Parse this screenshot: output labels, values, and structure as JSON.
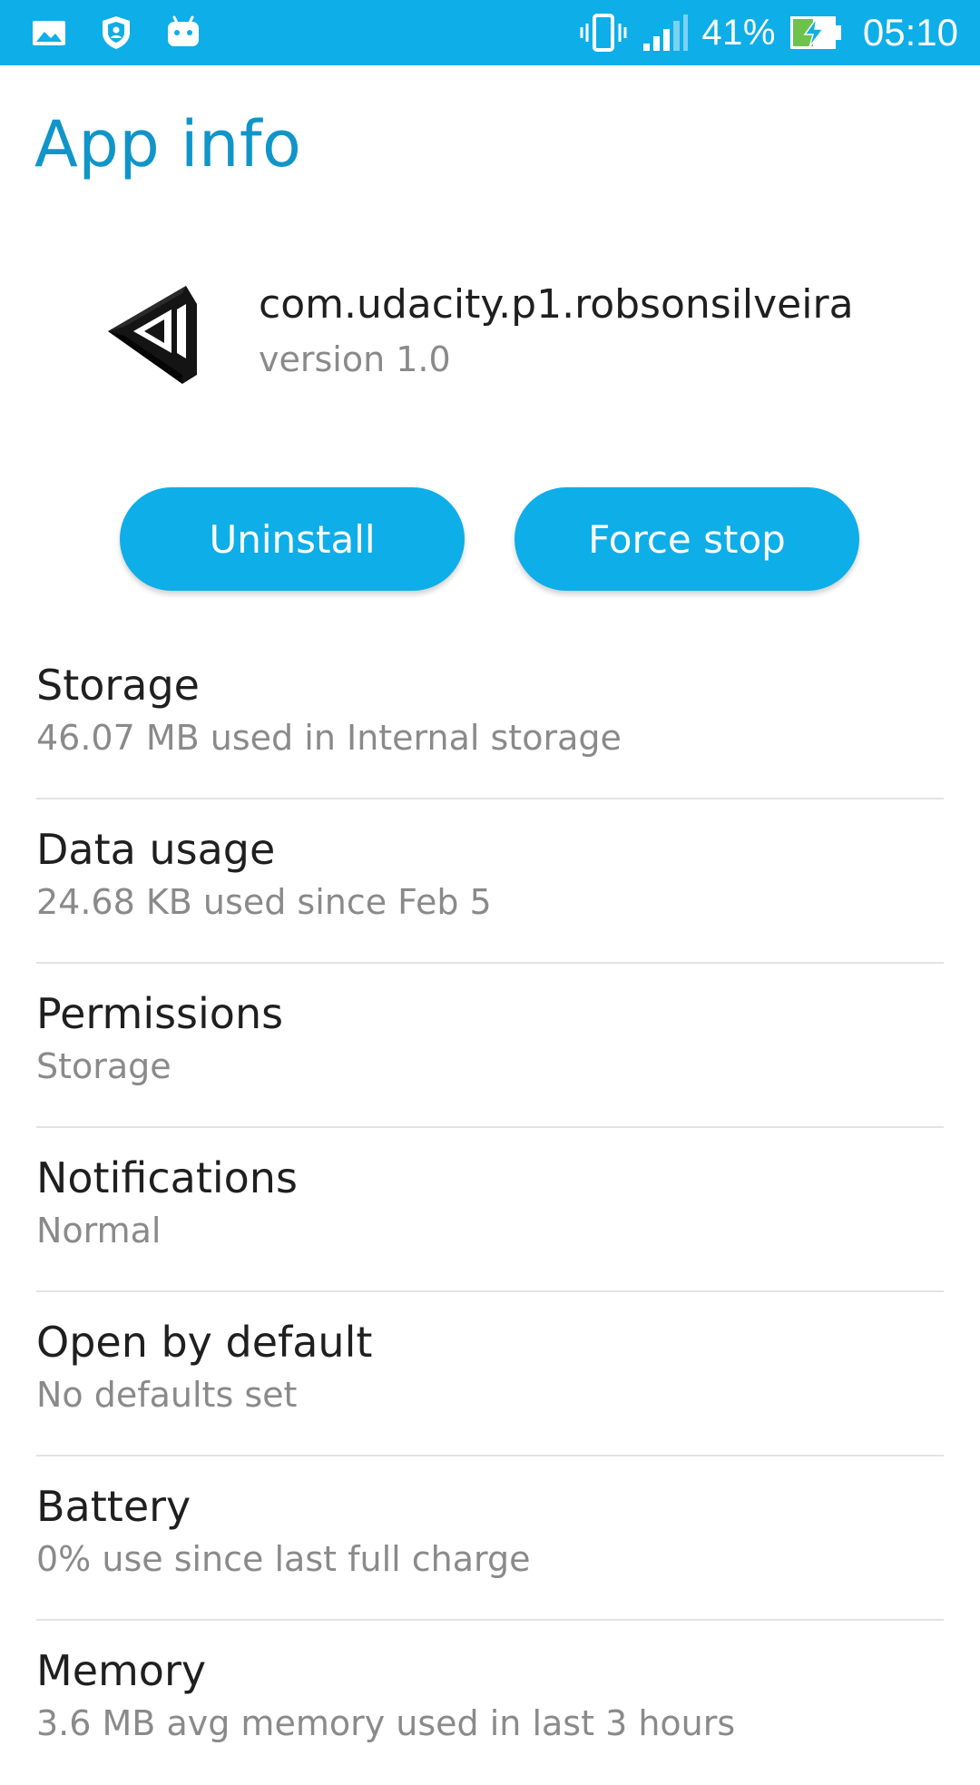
{
  "status_bar": {
    "icons_left": [
      "gallery-icon",
      "shield-icon",
      "android-icon"
    ],
    "vibrate_icon": "vibrate-icon",
    "signal_icon": "signal-icon",
    "battery_percent": "41%",
    "battery_icon": "battery-charging-icon",
    "time": "05:10",
    "background_color": "#0eaee8"
  },
  "page": {
    "title": "App info",
    "title_color": "#1095c9"
  },
  "app": {
    "logo_icon": "unity-logo-icon",
    "package_name": "com.udacity.p1.robsonsilveira",
    "version": "version 1.0"
  },
  "actions": {
    "uninstall_label": "Uninstall",
    "force_stop_label": "Force stop",
    "button_color": "#0eaee8"
  },
  "settings": [
    {
      "title": "Storage",
      "summary": "46.07 MB used in Internal storage"
    },
    {
      "title": "Data usage",
      "summary": "24.68 KB used since Feb 5"
    },
    {
      "title": "Permissions",
      "summary": "Storage"
    },
    {
      "title": "Notifications",
      "summary": "Normal"
    },
    {
      "title": "Open by default",
      "summary": "No defaults set"
    },
    {
      "title": "Battery",
      "summary": "0% use since last full charge"
    },
    {
      "title": "Memory",
      "summary": "3.6 MB avg memory used in last 3 hours"
    }
  ]
}
